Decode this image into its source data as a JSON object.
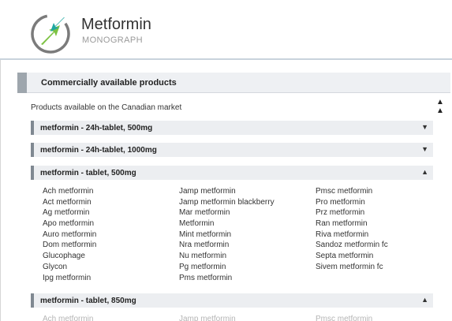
{
  "header": {
    "title": "Metformin",
    "subtitle": "MONOGRAPH"
  },
  "section": {
    "label": "Commercially available products"
  },
  "market_note": "Products available on the Canadian market",
  "collapse_all_icon": "double-chevron-up-icon",
  "products": [
    {
      "label": "metformin - 24h-tablet, 500mg",
      "state": "collapsed"
    },
    {
      "label": "metformin - 24h-tablet, 1000mg",
      "state": "collapsed"
    },
    {
      "label": "metformin - tablet, 500mg",
      "state": "expanded"
    },
    {
      "label": "metformin - tablet, 850mg",
      "state": "expanded"
    }
  ],
  "brands_500mg": {
    "col1": [
      "Ach metformin",
      "Act metformin",
      "Ag metformin",
      "Apo metformin",
      "Auro metformin",
      "Dom metformin",
      "Glucophage",
      "Glycon",
      "Ipg metformin"
    ],
    "col2": [
      "Jamp metformin",
      "Jamp metformin blackberry",
      "Mar metformin",
      "Metformin",
      "Mint metformin",
      "Nra metformin",
      "Nu metformin",
      "Pg metformin",
      "Pms metformin"
    ],
    "col3": [
      "Pmsc metformin",
      "Pro metformin",
      "Prz metformin",
      "Ran metformin",
      "Riva metformin",
      "Sandoz metformin fc",
      "Septa metformin",
      "Sivem metformin fc"
    ]
  },
  "brands_850mg_partial": [
    "Ach metformin",
    "Jamp metformin",
    "Pmsc metformin"
  ],
  "colors": {
    "logo_green": "#7cc242",
    "logo_teal": "#1fa7a0",
    "accent_bar": "#9ea6ad"
  }
}
